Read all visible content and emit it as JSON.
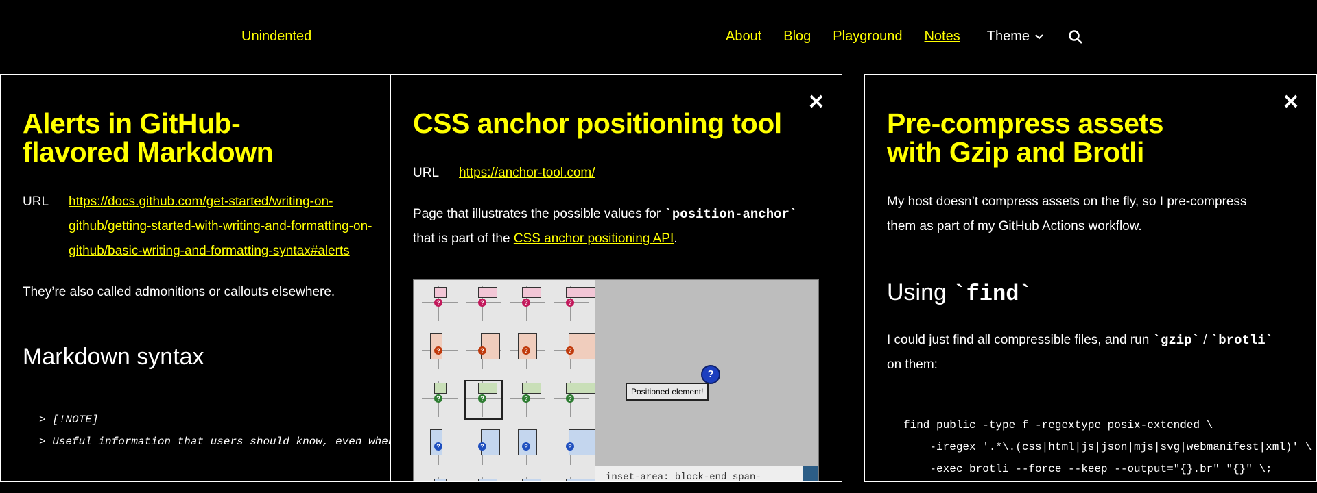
{
  "header": {
    "site_title": "Unindented",
    "nav": [
      {
        "label": "About"
      },
      {
        "label": "Blog"
      },
      {
        "label": "Playground"
      },
      {
        "label": "Notes",
        "current": true
      }
    ],
    "theme_label": "Theme"
  },
  "panel1": {
    "title_line1": "Alerts in GitHub-",
    "title_line2": "flavored Markdown",
    "url_label": "URL",
    "url_line1": "https://docs.github.com/get-started/writing-on-",
    "url_line2": "github/getting-started-with-writing-and-formatting-on-",
    "url_line3": "github/basic-writing-and-formatting-syntax#alerts",
    "paragraph": "They’re also called admonitions or callouts elsewhere.",
    "heading": "Markdown syntax",
    "code_line1": "> [!NOTE]",
    "code_line2": "> Useful information that users should know, even when skimming content."
  },
  "panel2": {
    "title": "CSS anchor positioning tool",
    "url_label": "URL",
    "url": "https://anchor-tool.com/",
    "para_prefix": "Page that illustrates the possible values for ",
    "para_code": "`position-anchor`",
    "para_mid": "that is part of the ",
    "para_link": "CSS anchor positioning API",
    "para_suffix": ".",
    "image": {
      "anchor_glyph": "?",
      "positioned_label": "Positioned element!",
      "code_snippet": "inset-area: block-end span-"
    }
  },
  "panel3": {
    "title_line1": "Pre-compress assets",
    "title_line2": "with Gzip and Brotli",
    "para1_line1": "My host doesn’t compress assets on the fly, so I pre-compress",
    "para1_line2": "them as part of my GitHub Actions workflow.",
    "heading_prefix": "Using ",
    "heading_code": "`find`",
    "para2_prefix": "I could just find all compressible files, and run ",
    "para2_code1": "`gzip`",
    "para2_sep": " / ",
    "para2_code2": "`brotli`",
    "para2_line2": "on them:",
    "code_line1": "find public -type f -regextype posix-extended \\",
    "code_line2": "    -iregex '.*\\.(css|html|js|json|mjs|svg|webmanifest|xml)' \\",
    "code_line3": "    -exec brotli --force --keep --output=\"{}.br\" \"{}\" \\;"
  },
  "colors": {
    "accent": "#ffff00",
    "background": "#000000",
    "text": "#ffffff"
  },
  "icons": [
    "chevron-down-icon",
    "search-icon",
    "close-icon"
  ]
}
